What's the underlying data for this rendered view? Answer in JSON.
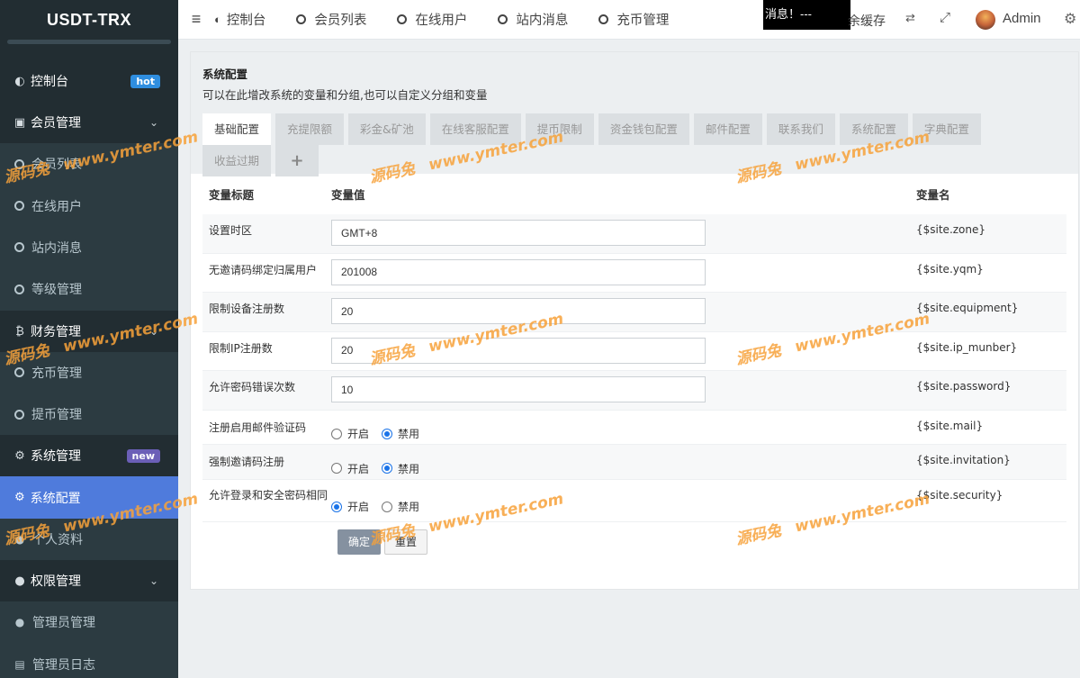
{
  "brand": "USDT-TRX",
  "sidebar": {
    "dashboard": {
      "label": "控制台",
      "badge": "hot"
    },
    "members": {
      "label": "会员管理",
      "items": [
        "会员列表",
        "在线用户",
        "站内消息",
        "等级管理"
      ]
    },
    "finance": {
      "label": "财务管理",
      "items": [
        "充币管理",
        "提币管理"
      ]
    },
    "system": {
      "label": "系统管理",
      "badge": "new",
      "items": [
        "系统配置",
        "个人资料"
      ]
    },
    "permission": {
      "label": "权限管理",
      "items": [
        "管理员管理",
        "管理员日志"
      ]
    }
  },
  "topbar": {
    "links": [
      "控制台",
      "会员列表",
      "在线用户",
      "站内消息",
      "充币管理"
    ],
    "message": "消息！---",
    "clear_cache": "余缓存",
    "user": "Admin"
  },
  "page": {
    "title": "系统配置",
    "description": "可以在此增改系统的变量和分组,也可以自定义分组和变量",
    "tabs": [
      "基础配置",
      "充提限额",
      "彩金&矿池",
      "在线客服配置",
      "提币限制",
      "资金钱包配置",
      "邮件配置",
      "联系我们",
      "系统配置",
      "字典配置",
      "收益过期",
      "+"
    ]
  },
  "table": {
    "headers": {
      "title": "变量标题",
      "value": "变量值",
      "name": "变量名"
    },
    "fields": [
      {
        "title": "设置时区",
        "value": "GMT+8",
        "var": "{$site.zone}"
      },
      {
        "title": "无邀请码绑定归属用户",
        "value": "201008",
        "var": "{$site.yqm}"
      },
      {
        "title": "限制设备注册数",
        "value": "20",
        "var": "{$site.equipment}"
      },
      {
        "title": "限制IP注册数",
        "value": "20",
        "var": "{$site.ip_munber}"
      },
      {
        "title": "允许密码错误次数",
        "value": "10",
        "var": "{$site.password}"
      }
    ],
    "radios": [
      {
        "title": "注册启用邮件验证码",
        "on": "开启",
        "off": "禁用",
        "selected": "禁用",
        "var": "{$site.mail}"
      },
      {
        "title": "强制邀请码注册",
        "on": "开启",
        "off": "禁用",
        "selected": "禁用",
        "var": "{$site.invitation}"
      },
      {
        "title": "允许登录和安全密码相同",
        "on": "开启",
        "off": "禁用",
        "selected": "开启",
        "var": "{$site.security}"
      }
    ]
  },
  "buttons": {
    "submit": "确定",
    "reset": "重置"
  },
  "watermark": {
    "cn": "源码兔",
    "url": "www.ymter.com"
  }
}
